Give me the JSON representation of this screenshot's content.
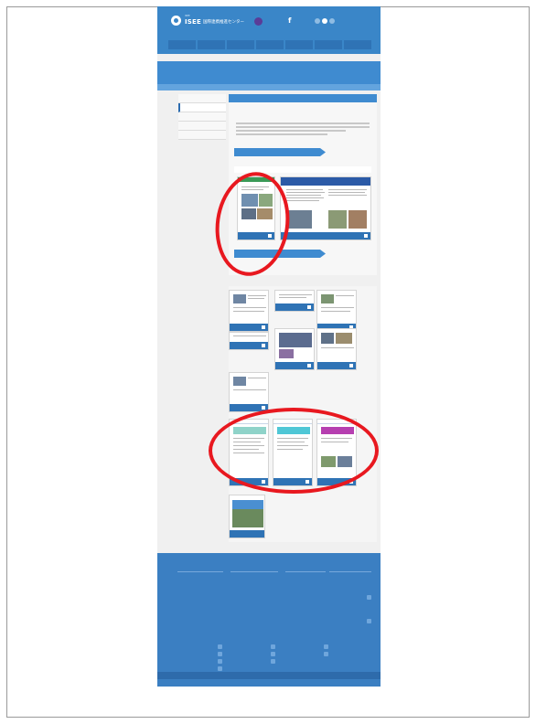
{
  "header": {
    "logo_sub": "ISEE",
    "logo_text": "ISEE",
    "logo_jp": "国際連携推進センター",
    "partner_text": "",
    "lang": "",
    "account": ""
  },
  "nav": {
    "items": [
      "",
      "",
      "",
      "",
      "",
      "",
      ""
    ]
  },
  "banner": {
    "title": "",
    "breadcrumb": ""
  },
  "sidebar": {
    "items": [
      "",
      "",
      "",
      "",
      ""
    ]
  },
  "main": {
    "heading": "",
    "subheading": "",
    "button_1": "",
    "strip_label": "",
    "button_2": ""
  },
  "feature_cards": [
    {
      "label": ""
    },
    {
      "label": ""
    }
  ],
  "sections": [
    {
      "label": ""
    },
    {
      "label": ""
    },
    {
      "label": ""
    }
  ],
  "newsletter_cards": [
    {
      "label": ""
    },
    {
      "label": ""
    },
    {
      "label": ""
    },
    {
      "label": ""
    },
    {
      "label": ""
    },
    {
      "label": ""
    },
    {
      "label": ""
    }
  ],
  "bottom_cards": [
    {
      "label": ""
    },
    {
      "label": ""
    },
    {
      "label": ""
    }
  ],
  "single_card": {
    "label": ""
  },
  "footer": {
    "col_heads": [
      "",
      "",
      "",
      ""
    ],
    "col_heads_2": [
      "",
      ""
    ],
    "links": [
      "",
      "",
      "",
      "",
      "",
      "",
      "",
      "",
      "",
      "",
      "",
      "",
      "",
      "",
      "",
      "",
      "",
      "",
      "",
      "",
      "",
      "",
      "",
      "",
      "",
      "",
      "",
      ""
    ],
    "bar_text": "",
    "copyright": ""
  },
  "colors": {
    "brand": "#3a86c8",
    "nav": "#2f73b5",
    "highlight_ring": "#e8181f"
  }
}
